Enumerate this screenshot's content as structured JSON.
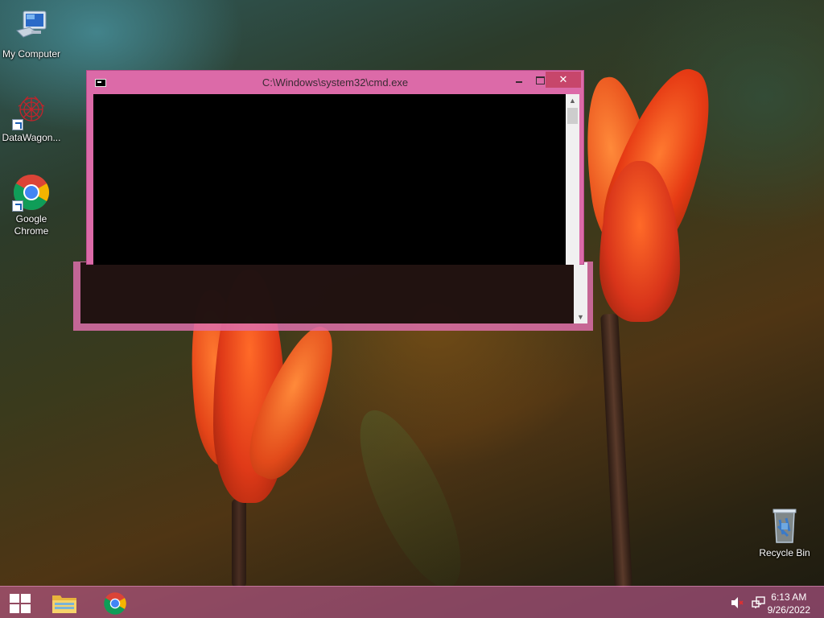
{
  "window": {
    "title": "C:\\Windows\\system32\\cmd.exe",
    "close_glyph": "✕"
  },
  "desktop_icons": [
    {
      "label": "My Computer",
      "icon": "computer-icon"
    },
    {
      "label": "DataWagon...",
      "icon": "datawagon-icon"
    },
    {
      "label": "Google\nChrome",
      "icon": "chrome-icon"
    },
    {
      "label": "Recycle Bin",
      "icon": "recycle-bin-icon"
    }
  ],
  "taskbar": {
    "apps": [
      {
        "name": "File Explorer",
        "icon": "folder-icon"
      },
      {
        "name": "Google Chrome",
        "icon": "chrome-icon"
      }
    ],
    "clock": {
      "time": "6:13 AM",
      "date": "9/26/2022"
    }
  },
  "colors": {
    "window_frame": "#dc6aa8",
    "close_button": "#c7466b",
    "taskbar": "#be5a91",
    "console_bg": "#000000"
  }
}
